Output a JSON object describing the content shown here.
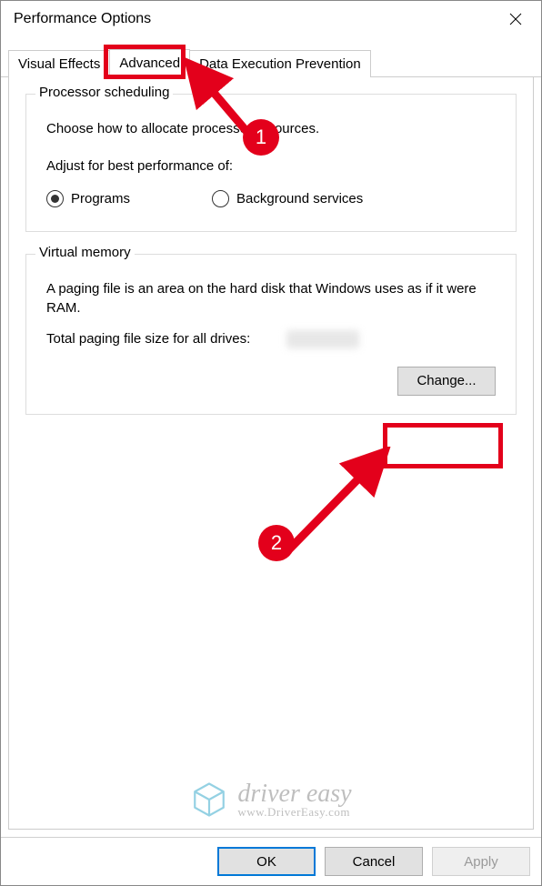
{
  "window": {
    "title": "Performance Options"
  },
  "tabs": {
    "items": [
      {
        "label": "Visual Effects",
        "selected": false
      },
      {
        "label": "Advanced",
        "selected": true
      },
      {
        "label": "Data Execution Prevention",
        "selected": false
      }
    ]
  },
  "processor_group": {
    "title": "Processor scheduling",
    "desc": "Choose how to allocate processor resources.",
    "sublabel": "Adjust for best performance of:",
    "radios": {
      "programs": {
        "label": "Programs",
        "checked": true
      },
      "background": {
        "label": "Background services",
        "checked": false
      }
    }
  },
  "vm_group": {
    "title": "Virtual memory",
    "desc": "A paging file is an area on the hard disk that Windows uses as if it were RAM.",
    "total_label": "Total paging file size for all drives:",
    "change_label": "Change..."
  },
  "buttons": {
    "ok": "OK",
    "cancel": "Cancel",
    "apply": "Apply"
  },
  "annotations": {
    "marker1": "1",
    "marker2": "2"
  },
  "watermark": {
    "brand": "driver easy",
    "url": "www.DriverEasy.com"
  }
}
